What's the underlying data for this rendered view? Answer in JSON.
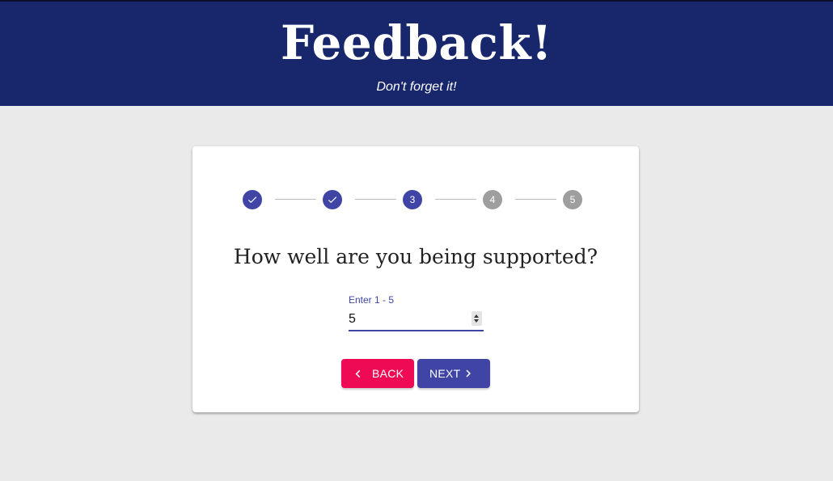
{
  "header": {
    "title": "Feedback!",
    "subtitle": "Don't forget it!"
  },
  "stepper": {
    "steps": [
      {
        "label": "1",
        "state": "done",
        "icon": "check-icon"
      },
      {
        "label": "2",
        "state": "done",
        "icon": "check-icon"
      },
      {
        "label": "3",
        "state": "active"
      },
      {
        "label": "4",
        "state": "todo"
      },
      {
        "label": "5",
        "state": "todo"
      }
    ]
  },
  "question": "How well are you being supported?",
  "rating_field": {
    "label": "Enter 1 - 5",
    "value": "5"
  },
  "buttons": {
    "back": "BACK",
    "next": "NEXT"
  },
  "colors": {
    "header": "#18266c",
    "primary": "#3f44a5",
    "accent": "#ee0a55",
    "inactive": "#9e9e9e"
  }
}
